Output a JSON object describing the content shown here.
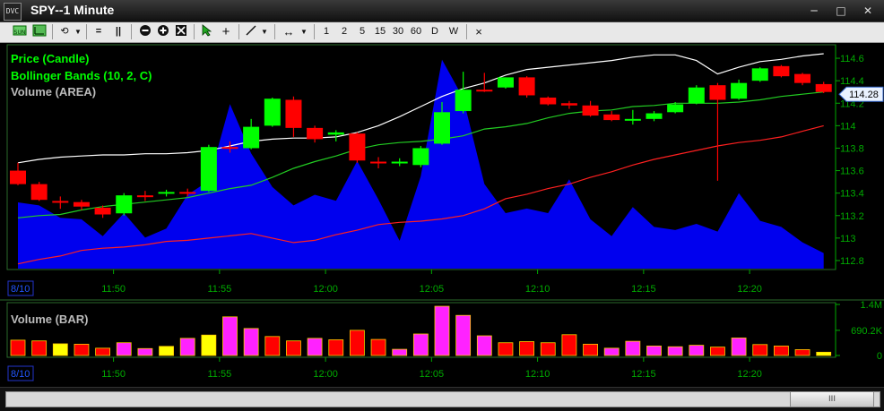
{
  "window": {
    "title": "SPY--1 Minute",
    "logo_text": "DVC",
    "minimize_icon": "minimize-icon",
    "maximize_icon": "maximize-icon",
    "close_icon": "close-icon"
  },
  "toolbar": {
    "items": [
      {
        "name": "sun-icon-button",
        "icon": "sun-icon"
      },
      {
        "name": "chart-style-button",
        "icon": "chart-icon"
      },
      {
        "name": "undo-button",
        "icon": "undo-icon"
      },
      {
        "name": "undo-dropdown",
        "icon": "chevron-down-icon"
      },
      {
        "name": "equal-button",
        "icon": "equal-icon"
      },
      {
        "name": "pause-button",
        "icon": "pause-icon"
      },
      {
        "name": "zoom-out-button",
        "icon": "zoom-out-icon"
      },
      {
        "name": "zoom-in-button",
        "icon": "zoom-in-icon"
      },
      {
        "name": "zoom-fit-button",
        "icon": "zoom-fit-icon"
      },
      {
        "name": "pointer-button",
        "icon": "pointer-icon"
      },
      {
        "name": "crosshair-button",
        "icon": "crosshair-icon"
      },
      {
        "name": "trendline-button",
        "icon": "trendline-icon"
      },
      {
        "name": "trendline-dropdown",
        "icon": "chevron-down-icon"
      },
      {
        "name": "scroll-button",
        "icon": "arrows-horizontal-icon"
      },
      {
        "name": "scroll-dropdown",
        "icon": "chevron-down-icon"
      }
    ],
    "intervals": [
      "1",
      "2",
      "5",
      "15",
      "30",
      "60",
      "D",
      "W"
    ],
    "close_panel_icon": "x-icon"
  },
  "colors": {
    "up": "#00ff00",
    "down": "#ff0000",
    "area": "#0000ee",
    "bb_upper": "#ffffff",
    "bb_middle": "#22cc22",
    "bb_lower": "#ff2020",
    "vol_big": "#ff22ff",
    "vol_small": "#ffff00",
    "axis": "#00aa00",
    "legend_price": "#00ff00",
    "legend_bb": "#00ff00",
    "legend_volume": "#bbbbbb"
  },
  "chart_data": [
    {
      "type": "candlestick",
      "title": "SPY--1 Minute",
      "legend": [
        "Price (Candle)",
        "Bollinger Bands (10, 2, C)",
        "Volume (AREA)"
      ],
      "x_tick_labels": [
        "11:50",
        "11:55",
        "12:00",
        "12:05",
        "12:10",
        "12:15",
        "12:20"
      ],
      "x_tick_index": [
        4,
        9,
        14,
        19,
        24,
        29,
        34
      ],
      "x_first_label": "8/10",
      "y_tick_labels": [
        "114.6",
        "114.4",
        "114.2",
        "114",
        "113.8",
        "113.6",
        "113.4",
        "113.2",
        "113",
        "112.8"
      ],
      "y_ticks": [
        114.6,
        114.4,
        114.2,
        114.0,
        113.8,
        113.6,
        113.4,
        113.2,
        113.0,
        112.8
      ],
      "ylim": [
        112.72,
        114.72
      ],
      "last_price_label": "114.28",
      "last_price": 114.28,
      "candles": [
        {
          "o": 113.6,
          "h": 113.67,
          "l": 113.47,
          "c": 113.48
        },
        {
          "o": 113.48,
          "h": 113.5,
          "l": 113.33,
          "c": 113.34
        },
        {
          "o": 113.33,
          "h": 113.37,
          "l": 113.26,
          "c": 113.32
        },
        {
          "o": 113.32,
          "h": 113.34,
          "l": 113.25,
          "c": 113.28
        },
        {
          "o": 113.27,
          "h": 113.29,
          "l": 113.18,
          "c": 113.21
        },
        {
          "o": 113.22,
          "h": 113.4,
          "l": 113.2,
          "c": 113.38
        },
        {
          "o": 113.38,
          "h": 113.42,
          "l": 113.33,
          "c": 113.37
        },
        {
          "o": 113.4,
          "h": 113.43,
          "l": 113.37,
          "c": 113.41
        },
        {
          "o": 113.41,
          "h": 113.44,
          "l": 113.37,
          "c": 113.4
        },
        {
          "o": 113.42,
          "h": 113.83,
          "l": 113.41,
          "c": 113.81
        },
        {
          "o": 113.81,
          "h": 113.86,
          "l": 113.76,
          "c": 113.8
        },
        {
          "o": 113.8,
          "h": 114.06,
          "l": 113.79,
          "c": 113.99
        },
        {
          "o": 114.0,
          "h": 114.25,
          "l": 113.99,
          "c": 114.24
        },
        {
          "o": 114.23,
          "h": 114.26,
          "l": 113.9,
          "c": 113.98
        },
        {
          "o": 113.98,
          "h": 114.0,
          "l": 113.85,
          "c": 113.88
        },
        {
          "o": 113.92,
          "h": 113.96,
          "l": 113.86,
          "c": 113.94
        },
        {
          "o": 113.93,
          "h": 113.94,
          "l": 113.67,
          "c": 113.69
        },
        {
          "o": 113.68,
          "h": 113.72,
          "l": 113.62,
          "c": 113.67
        },
        {
          "o": 113.68,
          "h": 113.71,
          "l": 113.64,
          "c": 113.68
        },
        {
          "o": 113.65,
          "h": 113.82,
          "l": 113.63,
          "c": 113.8
        },
        {
          "o": 113.84,
          "h": 114.21,
          "l": 113.83,
          "c": 114.12
        },
        {
          "o": 114.13,
          "h": 114.48,
          "l": 114.11,
          "c": 114.32
        },
        {
          "o": 114.32,
          "h": 114.47,
          "l": 114.3,
          "c": 114.31
        },
        {
          "o": 114.34,
          "h": 114.43,
          "l": 114.33,
          "c": 114.43
        },
        {
          "o": 114.43,
          "h": 114.44,
          "l": 114.25,
          "c": 114.27
        },
        {
          "o": 114.25,
          "h": 114.26,
          "l": 114.18,
          "c": 114.19
        },
        {
          "o": 114.2,
          "h": 114.22,
          "l": 114.15,
          "c": 114.18
        },
        {
          "o": 114.18,
          "h": 114.22,
          "l": 114.08,
          "c": 114.09
        },
        {
          "o": 114.1,
          "h": 114.13,
          "l": 114.04,
          "c": 114.05
        },
        {
          "o": 114.05,
          "h": 114.14,
          "l": 114.01,
          "c": 114.06
        },
        {
          "o": 114.06,
          "h": 114.13,
          "l": 114.04,
          "c": 114.11
        },
        {
          "o": 114.12,
          "h": 114.21,
          "l": 114.11,
          "c": 114.19
        },
        {
          "o": 114.2,
          "h": 114.36,
          "l": 114.19,
          "c": 114.34
        },
        {
          "o": 114.36,
          "h": 114.38,
          "l": 113.51,
          "c": 114.23
        },
        {
          "o": 114.24,
          "h": 114.41,
          "l": 114.23,
          "c": 114.38
        },
        {
          "o": 114.4,
          "h": 114.52,
          "l": 114.39,
          "c": 114.51
        },
        {
          "o": 114.53,
          "h": 114.54,
          "l": 114.43,
          "c": 114.44
        },
        {
          "o": 114.46,
          "h": 114.47,
          "l": 114.36,
          "c": 114.38
        },
        {
          "o": 114.37,
          "h": 114.39,
          "l": 114.29,
          "c": 114.3
        }
      ],
      "bollinger_upper": [
        113.67,
        113.7,
        113.72,
        113.73,
        113.74,
        113.74,
        113.75,
        113.75,
        113.76,
        113.78,
        113.82,
        113.86,
        113.88,
        113.89,
        113.89,
        113.9,
        113.94,
        114.0,
        114.08,
        114.17,
        114.26,
        114.33,
        114.38,
        114.45,
        114.5,
        114.52,
        114.54,
        114.56,
        114.58,
        114.61,
        114.63,
        114.63,
        114.58,
        114.46,
        114.52,
        114.57,
        114.59,
        114.62,
        114.64
      ],
      "bollinger_middle": [
        113.18,
        113.2,
        113.21,
        113.25,
        113.28,
        113.3,
        113.32,
        113.34,
        113.36,
        113.4,
        113.44,
        113.47,
        113.54,
        113.62,
        113.68,
        113.73,
        113.79,
        113.83,
        113.85,
        113.86,
        113.88,
        113.91,
        113.97,
        113.99,
        114.02,
        114.07,
        114.11,
        114.13,
        114.14,
        114.17,
        114.18,
        114.2,
        114.2,
        114.2,
        114.21,
        114.23,
        114.26,
        114.28,
        114.3
      ],
      "bollinger_lower": [
        112.77,
        112.81,
        112.84,
        112.89,
        112.91,
        112.92,
        112.94,
        112.97,
        112.98,
        113.0,
        113.02,
        113.04,
        113.0,
        112.96,
        112.98,
        113.03,
        113.07,
        113.12,
        113.14,
        113.15,
        113.17,
        113.2,
        113.26,
        113.35,
        113.39,
        113.44,
        113.48,
        113.54,
        113.59,
        113.65,
        113.7,
        113.74,
        113.78,
        113.82,
        113.85,
        113.87,
        113.9,
        113.95,
        114.0
      ],
      "volume_area_label": "Volume (AREA)"
    },
    {
      "type": "bar",
      "title": "Volume (BAR)",
      "y_tick_labels": [
        "1.4M",
        "690.2K",
        "0"
      ],
      "y_ticks": [
        1400000,
        690200,
        0
      ],
      "ylim": [
        0,
        1400000
      ],
      "x_tick_labels": [
        "11:50",
        "11:55",
        "12:00",
        "12:05",
        "12:10",
        "12:15",
        "12:20"
      ],
      "x_first_label": "8/10",
      "values": [
        420000,
        400000,
        320000,
        310000,
        200000,
        350000,
        190000,
        250000,
        470000,
        560000,
        1060000,
        740000,
        520000,
        400000,
        470000,
        430000,
        690000,
        440000,
        170000,
        590000,
        1350000,
        1100000,
        540000,
        350000,
        380000,
        350000,
        570000,
        310000,
        200000,
        390000,
        260000,
        240000,
        280000,
        230000,
        480000,
        300000,
        260000,
        160000,
        90000
      ],
      "bar_colors": [
        "down",
        "down",
        "small",
        "down",
        "down",
        "big",
        "big",
        "small",
        "big",
        "small",
        "big",
        "big",
        "down",
        "down",
        "big",
        "down",
        "down",
        "down",
        "big",
        "big",
        "big",
        "big",
        "big",
        "down",
        "down",
        "down",
        "down",
        "down",
        "big",
        "big",
        "big",
        "big",
        "big",
        "down",
        "big",
        "down",
        "down",
        "down",
        "small"
      ]
    }
  ],
  "scrollbar": {
    "thumb_label": "III"
  }
}
